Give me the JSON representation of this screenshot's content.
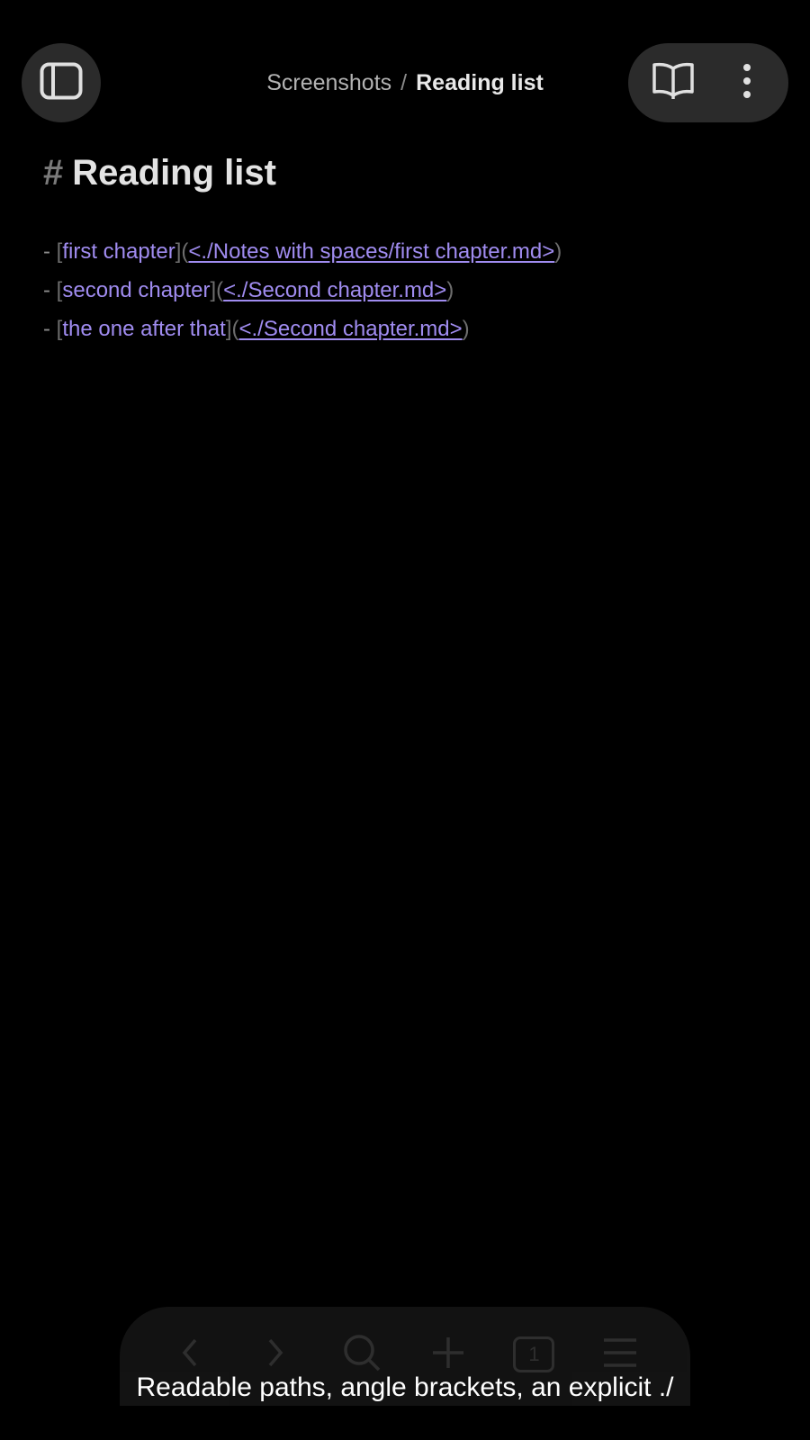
{
  "header": {
    "breadcrumb_parent": "Screenshots",
    "breadcrumb_separator": "/",
    "breadcrumb_current": "Reading list",
    "icons": [
      "sidebar-toggle-icon",
      "reading-mode-icon",
      "more-options-icon"
    ]
  },
  "note": {
    "heading_marker": "#",
    "heading": "Reading list",
    "items": [
      {
        "dash": "-",
        "open_bracket": "[",
        "text": "first chapter",
        "mid": "](",
        "url": "<./Notes with spaces/first chapter.md>",
        "close": ")"
      },
      {
        "dash": "-",
        "open_bracket": "[",
        "text": "second chapter",
        "mid": "](",
        "url": "<./Second chapter.md>",
        "close": ")"
      },
      {
        "dash": "-",
        "open_bracket": "[",
        "text": "the one after that",
        "mid": "](",
        "url": "<./Second chapter.md>",
        "close": ")"
      }
    ]
  },
  "toolbar": {
    "tab_count": "1",
    "icons": [
      "back-icon",
      "forward-icon",
      "search-icon",
      "new-tab-icon",
      "tabs-icon",
      "menu-icon"
    ]
  },
  "caption": "Readable paths, angle brackets, an explicit ./",
  "colors": {
    "background": "#000000",
    "button_bg": "#2b2b2b",
    "link": "#a08cf0",
    "syntax": "#6d6d6d"
  }
}
